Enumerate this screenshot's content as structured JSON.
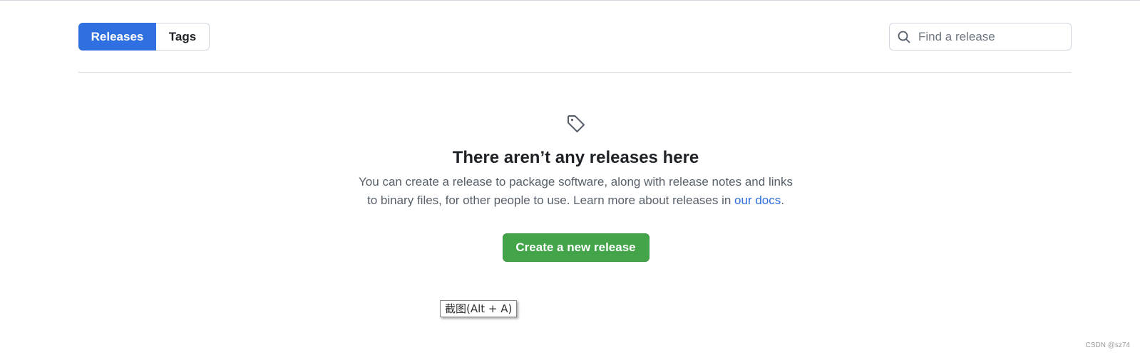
{
  "subnav": {
    "releases_label": "Releases",
    "tags_label": "Tags"
  },
  "search": {
    "placeholder": "Find a release",
    "icon": "search-icon"
  },
  "blankslate": {
    "icon": "tag-icon",
    "title": "There aren’t any releases here",
    "description": "You can create a release to package software, along with release notes and links to binary files, for other people to use. Learn more about releases in ",
    "link_text": "our docs",
    "description_end": ".",
    "create_button_label": "Create a new release"
  },
  "tooltip": {
    "text": "截图(Alt + A)"
  },
  "watermark": {
    "text": "CSDN @sz74"
  },
  "colors": {
    "accent_blue": "#2f6fe0",
    "button_green": "#44a449",
    "border": "#d0d7de",
    "muted_text": "#57606a"
  }
}
